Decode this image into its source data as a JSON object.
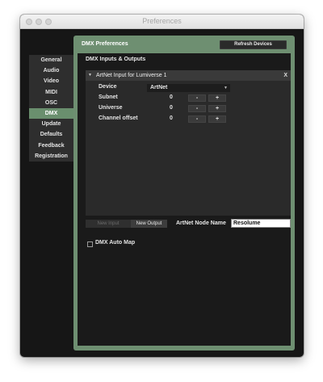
{
  "window": {
    "title": "Preferences"
  },
  "sidebar": {
    "items": [
      {
        "label": "General",
        "active": false
      },
      {
        "label": "Audio",
        "active": false
      },
      {
        "label": "Video",
        "active": false
      },
      {
        "label": "MIDI",
        "active": false
      },
      {
        "label": "OSC",
        "active": false
      },
      {
        "label": "DMX",
        "active": true
      },
      {
        "label": "Update",
        "active": false
      },
      {
        "label": "Defaults",
        "active": false
      },
      {
        "label": "Feedback",
        "active": false
      },
      {
        "label": "Registration",
        "active": false
      }
    ]
  },
  "panel": {
    "title": "DMX Preferences",
    "refresh_label": "Refresh Devices",
    "section_title": "DMX Inputs & Outputs",
    "io": {
      "header_label": "ArtNet Input for Lumiverse 1",
      "close_label": "X",
      "device_label": "Device",
      "device_value": "ArtNet",
      "subnet_label": "Subnet",
      "subnet_value": "0",
      "universe_label": "Universe",
      "universe_value": "0",
      "channel_offset_label": "Channel offset",
      "channel_offset_value": "0",
      "minus_label": "-",
      "plus_label": "+"
    },
    "new_input_label": "New Input",
    "new_output_label": "New Output",
    "node_name_label": "ArtNet Node Name",
    "node_name_value": "Resolume",
    "auto_map_label": "DMX Auto Map"
  },
  "colors": {
    "accent": "#6e8f71",
    "active_item": "#6a8f6e",
    "background": "#161616"
  }
}
